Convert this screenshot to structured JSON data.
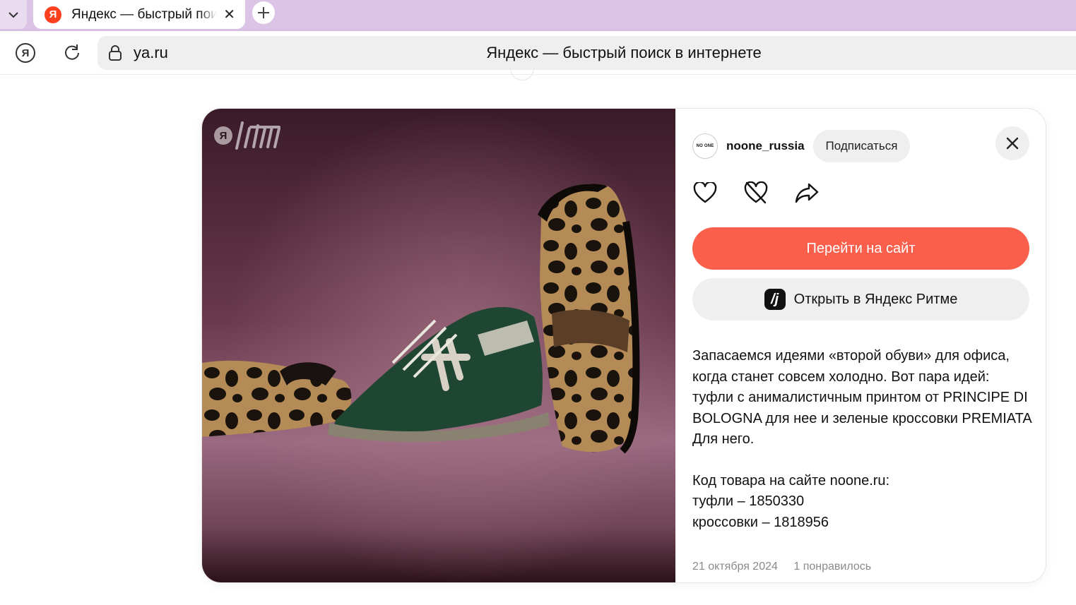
{
  "browser": {
    "tab": {
      "title": "Яндекс — быстрый поиск в интернете",
      "favicon_letter": "Я"
    },
    "address": {
      "url": "ya.ru",
      "page_title": "Яндекс — быстрый поиск в интернете"
    },
    "nav_ya_letter": "Я"
  },
  "card": {
    "image_logo_letter": "Я",
    "author": {
      "name": "noone_russia",
      "avatar_text": "NO ONE"
    },
    "subscribe_label": "Подписаться",
    "primary_button": "Перейти на сайт",
    "secondary_button": "Открыть в Яндекс Ритме",
    "description": {
      "paragraph1": "Запасаемся идеями «второй обуви» для офиса, когда станет совсем холодно. Вот пара идей: туфли с анималистичным принтом от PRINCIPE DI BOLOGNA для нее и зеленые кроссовки PREMIATA Для него.",
      "line1": "Код товара на сайте noone.ru:",
      "line2": "туфли – 1850330",
      "line3": "кроссовки – 1818956"
    },
    "date": "21 октября 2024",
    "likes": "1 понравилось"
  },
  "colors": {
    "accent": "#f95f4a",
    "tabstrip": "#dcc4e6",
    "yandex_red": "#fc3f1d"
  }
}
